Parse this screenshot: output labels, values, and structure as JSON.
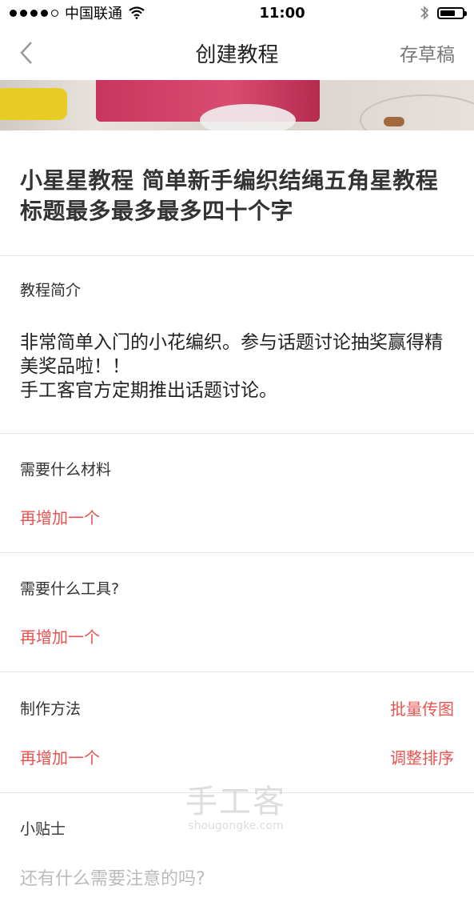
{
  "status": {
    "carrier": "中国联通",
    "time": "11:00"
  },
  "nav": {
    "title": "创建教程",
    "draft": "存草稿"
  },
  "tutorial": {
    "title": "小星星教程 简单新手编织结绳五角星教程标题最多最多最多四十个字"
  },
  "intro": {
    "label": "教程简介",
    "text": "非常简单入门的小花编织。参与话题讨论抽奖赢得精美奖品啦！！\n手工客官方定期推出话题讨论。"
  },
  "materials": {
    "label": "需要什么材料",
    "add": "再增加一个"
  },
  "tools": {
    "label": "需要什么工具?",
    "add": "再增加一个"
  },
  "method": {
    "label": "制作方法",
    "batch": "批量传图",
    "add": "再增加一个",
    "sort": "调整排序"
  },
  "tips": {
    "label": "小贴士",
    "placeholder": "还有什么需要注意的吗?"
  },
  "watermark": {
    "name": "手工客",
    "url": "shougongke.com"
  },
  "colors": {
    "accent": "#e8524f"
  }
}
